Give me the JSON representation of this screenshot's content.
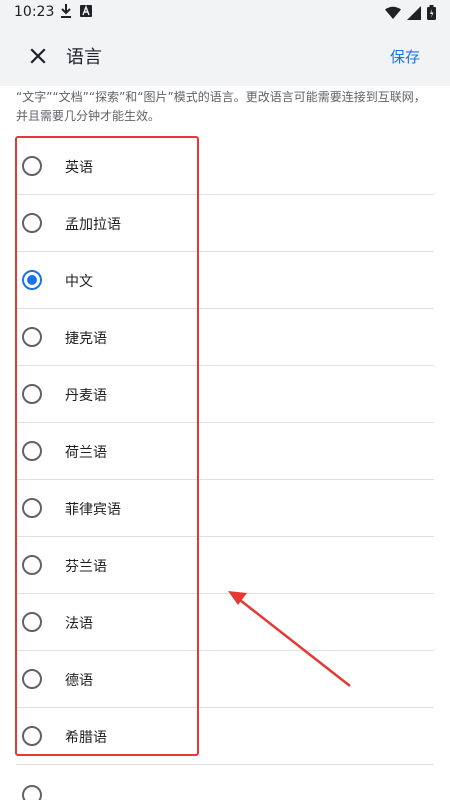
{
  "status_bar": {
    "time": "10:23",
    "left_icons": [
      "download-icon",
      "notification-a-icon"
    ],
    "right_icons": [
      "wifi-icon",
      "signal-icon",
      "battery-icon"
    ]
  },
  "app_bar": {
    "close_icon": "close-icon",
    "title": "语言",
    "save_label": "保存"
  },
  "description": "“文字”“文档”“探索”和“图片”模式的语言。更改语言可能需要连接到互联网，并且需要几分钟才能生效。",
  "languages": [
    {
      "label": "英语",
      "selected": false
    },
    {
      "label": "孟加拉语",
      "selected": false
    },
    {
      "label": "中文",
      "selected": true
    },
    {
      "label": "捷克语",
      "selected": false
    },
    {
      "label": "丹麦语",
      "selected": false
    },
    {
      "label": "荷兰语",
      "selected": false
    },
    {
      "label": "菲律宾语",
      "selected": false
    },
    {
      "label": "芬兰语",
      "selected": false
    },
    {
      "label": "法语",
      "selected": false
    },
    {
      "label": "德语",
      "selected": false
    },
    {
      "label": "希腊语",
      "selected": false
    }
  ],
  "colors": {
    "accent": "#1a73e8",
    "annotation": "#e53935",
    "header_bg": "#f1f3f4"
  }
}
